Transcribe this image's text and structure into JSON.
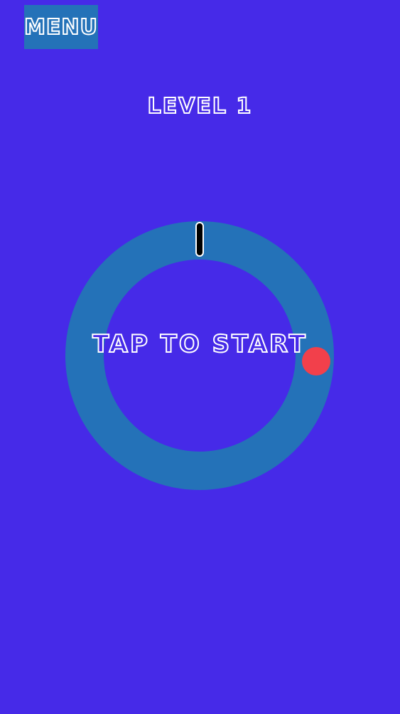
{
  "menu": {
    "label": "MENU"
  },
  "level": {
    "label": "LEVEL 1"
  },
  "game": {
    "prompt": "TAP TO START",
    "colors": {
      "background": "#462AE8",
      "ring": "#2472B8",
      "ball": "#F2404B",
      "target_marker": "#000000",
      "target_marker_outline": "#ffffff"
    }
  }
}
